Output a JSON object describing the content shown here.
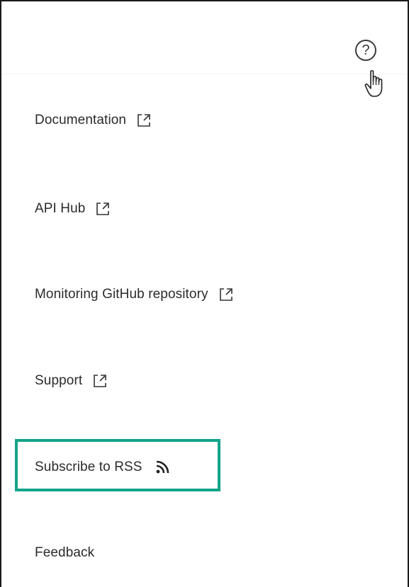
{
  "header": {
    "help_glyph": "?"
  },
  "menu": {
    "items": [
      {
        "label": "Documentation",
        "icon": "external-link-icon"
      },
      {
        "label": "API Hub",
        "icon": "external-link-icon"
      },
      {
        "label": "Monitoring GitHub repository",
        "icon": "external-link-icon"
      },
      {
        "label": "Support",
        "icon": "external-link-icon"
      },
      {
        "label": "Subscribe to RSS",
        "icon": "rss-icon"
      },
      {
        "label": "Feedback",
        "icon": ""
      }
    ]
  },
  "colors": {
    "highlight": "#12a38a",
    "text": "#2b2b2b"
  }
}
